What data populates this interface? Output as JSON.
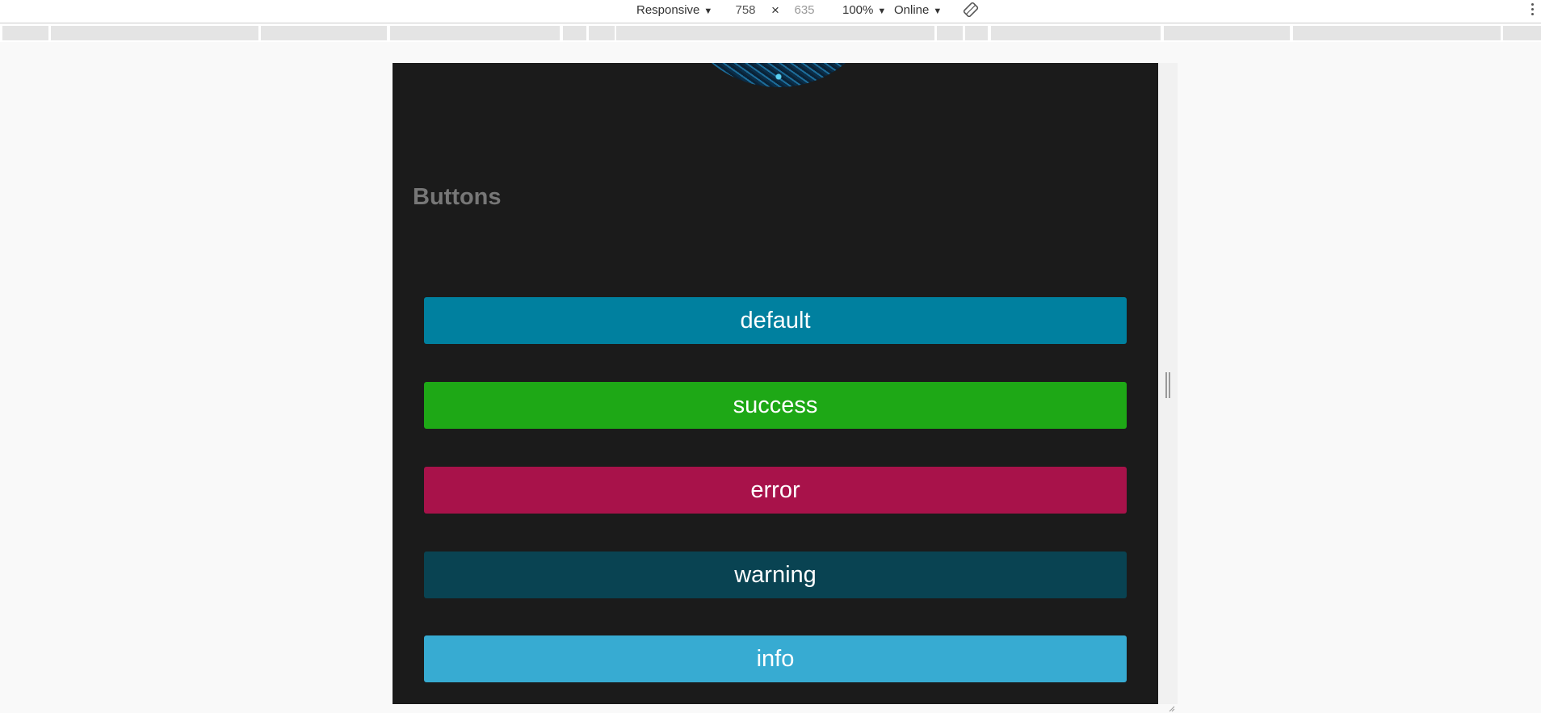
{
  "toolbar": {
    "device_mode": "Responsive",
    "width": "758",
    "times": "×",
    "height": "635",
    "zoom": "100%",
    "network": "Online",
    "caret": "▼",
    "icons": [
      "rotate-icon",
      "more-options-icon"
    ]
  },
  "page": {
    "section_title": "Buttons",
    "buttons": [
      {
        "label": "default",
        "color": "#00809f"
      },
      {
        "label": "success",
        "color": "#1ea816"
      },
      {
        "label": "error",
        "color": "#a8124a"
      },
      {
        "label": "warning",
        "color": "#094352"
      },
      {
        "label": "info",
        "color": "#37abd2"
      }
    ]
  },
  "colors": {
    "viewport_background": "#1b1b1b",
    "title_text": "#777777",
    "chrome_background": "#f9f9f9"
  }
}
